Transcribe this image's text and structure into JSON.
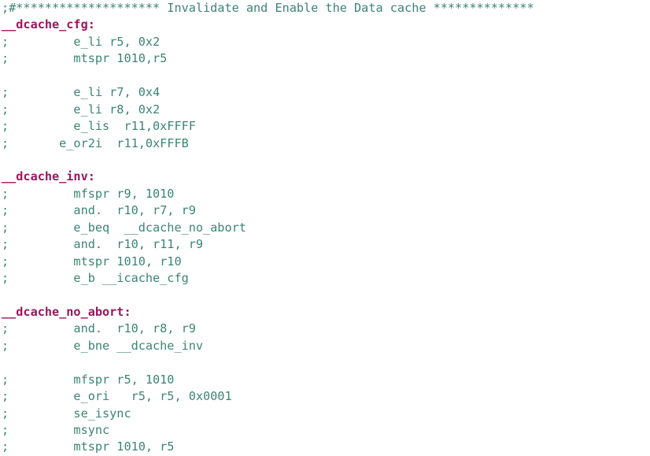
{
  "editor": {
    "background_color": "#ffffff",
    "comment_color": "#3c8474",
    "label_color": "#95185e",
    "font_size_px": 15.2,
    "line_height_px": 21.45,
    "language": "PowerPC VLE Assembly"
  },
  "lines": [
    {
      "n": 1,
      "kind": "comment",
      "text": ";#******************** Invalidate and Enable the Data cache **************"
    },
    {
      "n": 2,
      "kind": "label",
      "text": "__dcache_cfg:"
    },
    {
      "n": 3,
      "kind": "comment",
      "text": ";         e_li r5, 0x2"
    },
    {
      "n": 4,
      "kind": "comment",
      "text": ";         mtspr 1010,r5"
    },
    {
      "n": 5,
      "kind": "blank",
      "text": ""
    },
    {
      "n": 6,
      "kind": "comment",
      "text": ";         e_li r7, 0x4"
    },
    {
      "n": 7,
      "kind": "comment",
      "text": ";         e_li r8, 0x2"
    },
    {
      "n": 8,
      "kind": "comment",
      "text": ";         e_lis  r11,0xFFFF"
    },
    {
      "n": 9,
      "kind": "comment",
      "text": ";       e_or2i  r11,0xFFFB"
    },
    {
      "n": 10,
      "kind": "blank",
      "text": ""
    },
    {
      "n": 11,
      "kind": "label",
      "text": "__dcache_inv:"
    },
    {
      "n": 12,
      "kind": "comment",
      "text": ";         mfspr r9, 1010"
    },
    {
      "n": 13,
      "kind": "comment",
      "text": ";         and.  r10, r7, r9"
    },
    {
      "n": 14,
      "kind": "comment",
      "text": ";         e_beq  __dcache_no_abort"
    },
    {
      "n": 15,
      "kind": "comment",
      "text": ";         and.  r10, r11, r9"
    },
    {
      "n": 16,
      "kind": "comment",
      "text": ";         mtspr 1010, r10"
    },
    {
      "n": 17,
      "kind": "comment",
      "text": ";         e_b __icache_cfg"
    },
    {
      "n": 18,
      "kind": "blank",
      "text": ""
    },
    {
      "n": 19,
      "kind": "label",
      "text": "__dcache_no_abort:"
    },
    {
      "n": 20,
      "kind": "comment",
      "text": ";         and.  r10, r8, r9"
    },
    {
      "n": 21,
      "kind": "comment",
      "text": ";         e_bne __dcache_inv"
    },
    {
      "n": 22,
      "kind": "blank",
      "text": ""
    },
    {
      "n": 23,
      "kind": "comment",
      "text": ";         mfspr r5, 1010"
    },
    {
      "n": 24,
      "kind": "comment",
      "text": ";         e_ori   r5, r5, 0x0001"
    },
    {
      "n": 25,
      "kind": "comment",
      "text": ";         se_isync"
    },
    {
      "n": 26,
      "kind": "comment",
      "text": ";         msync"
    },
    {
      "n": 27,
      "kind": "comment",
      "text": ";         mtspr 1010, r5"
    }
  ]
}
